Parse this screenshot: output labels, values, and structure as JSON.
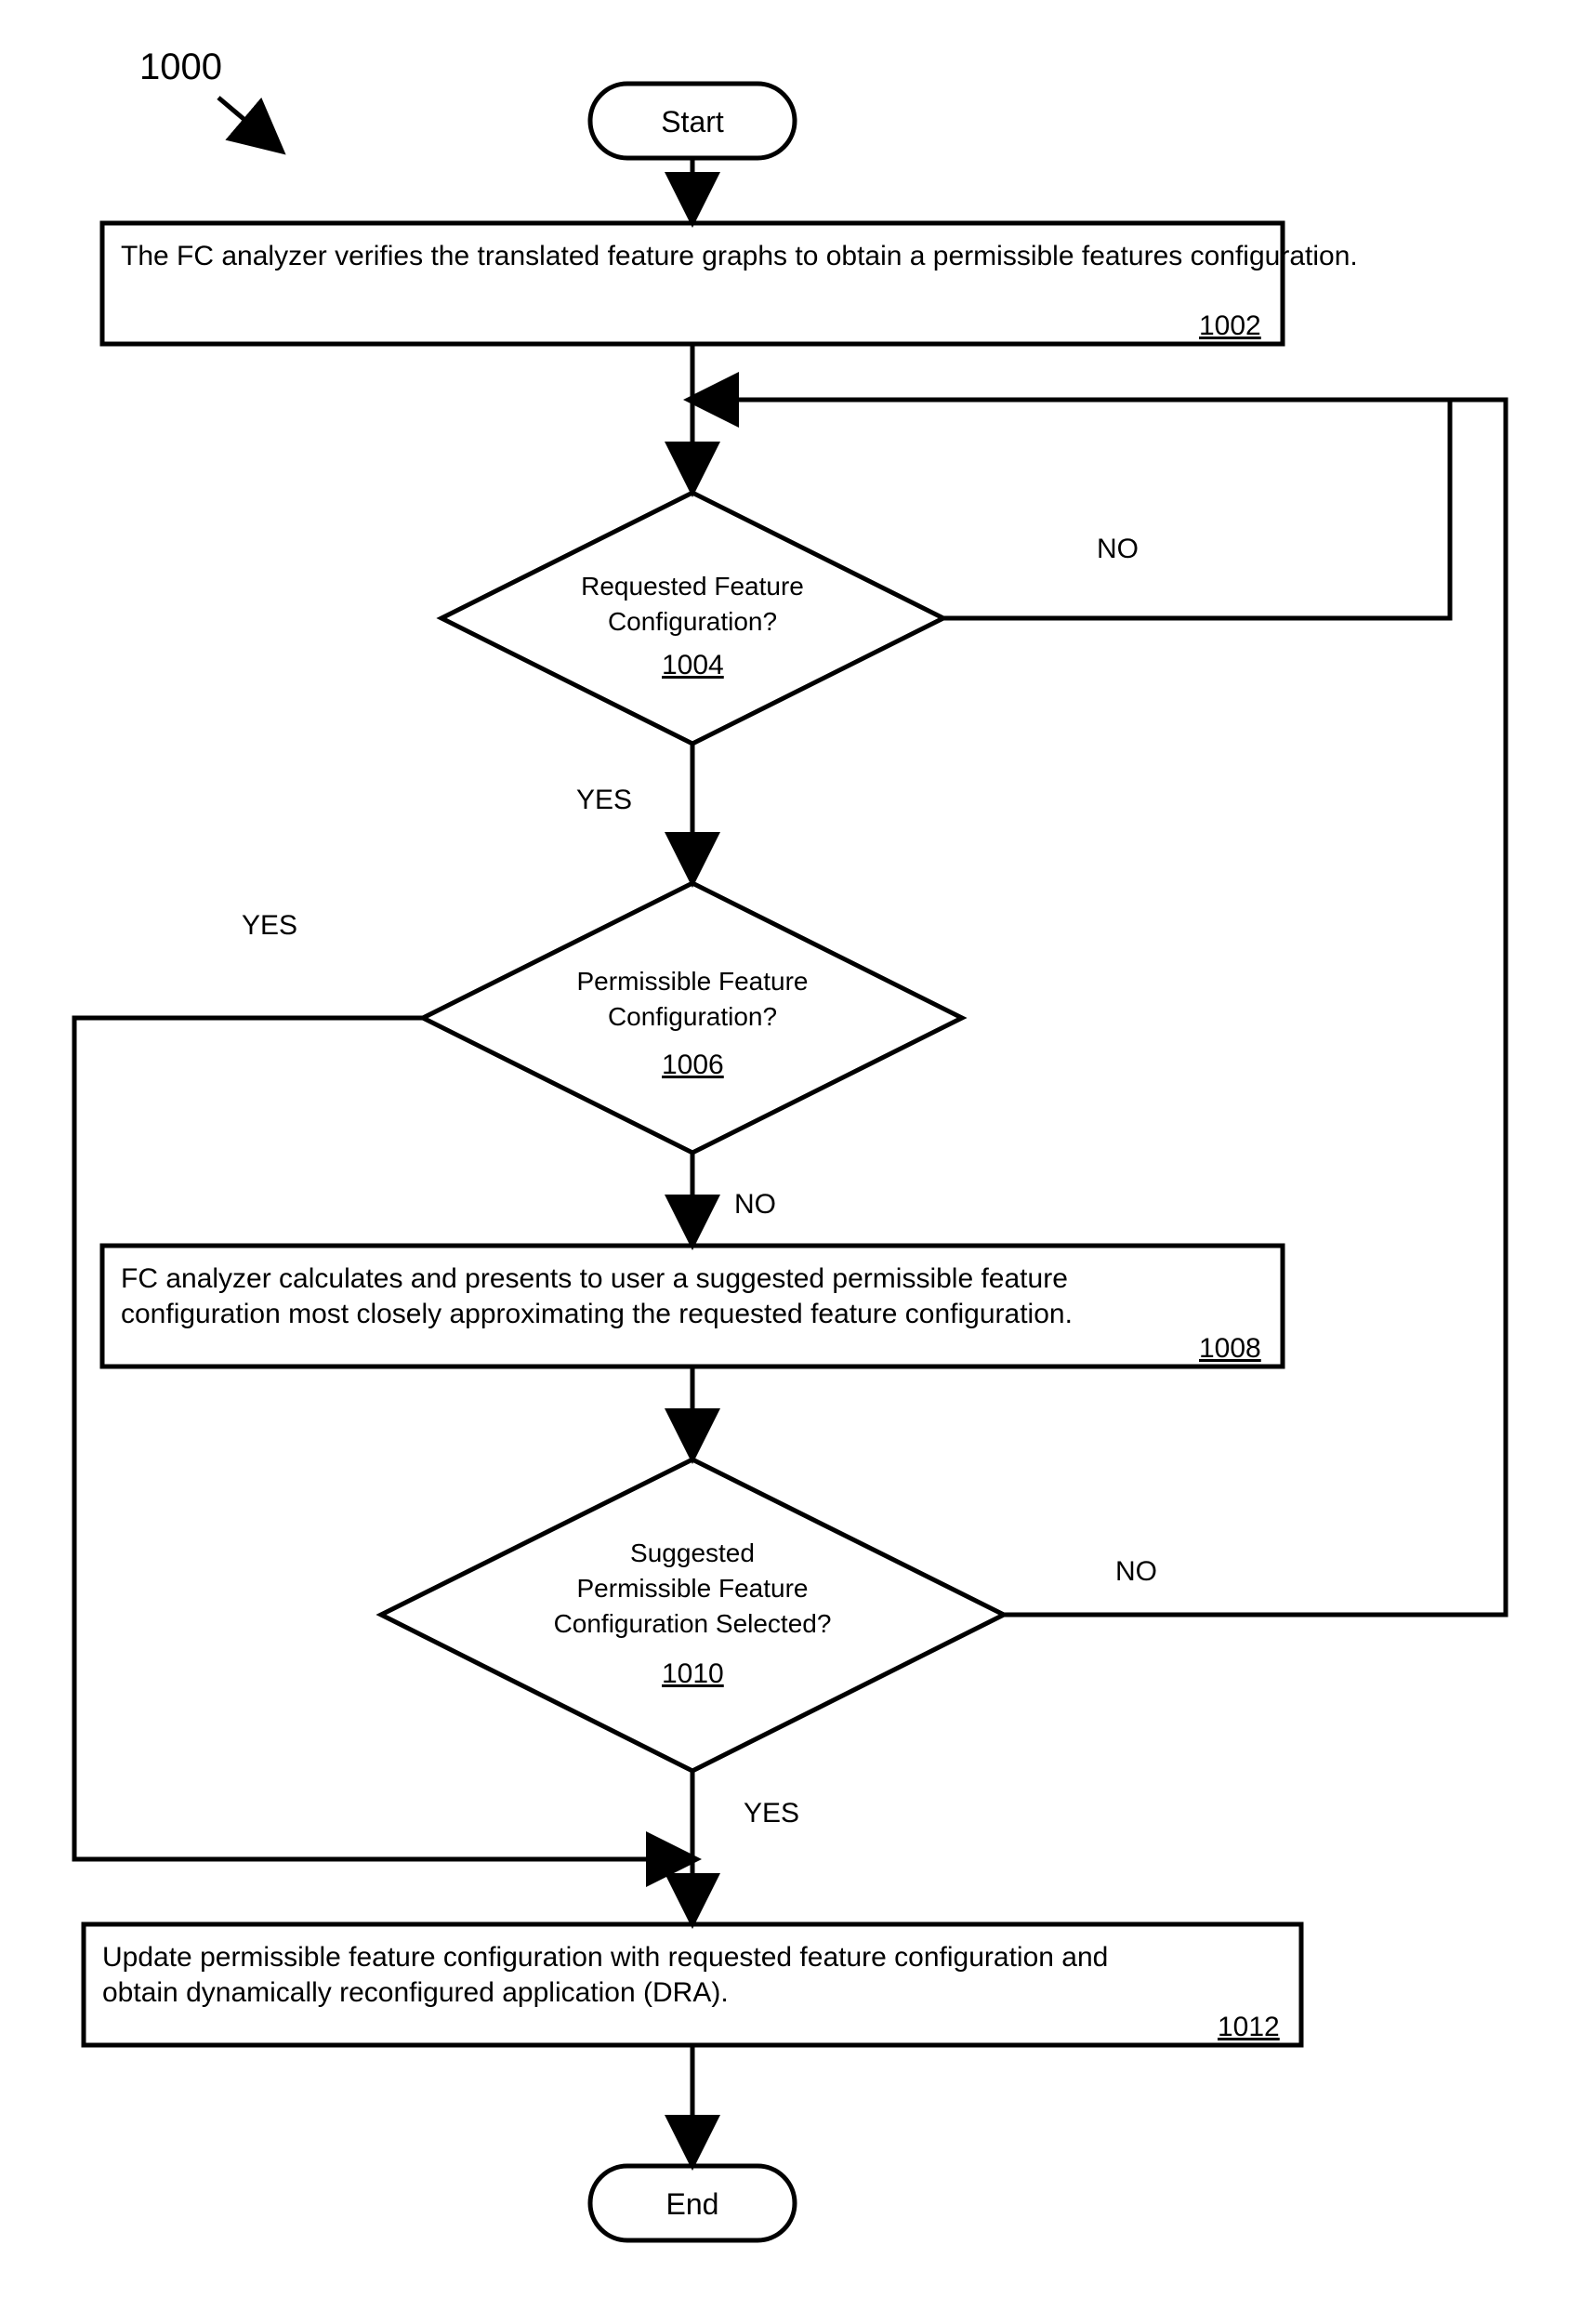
{
  "figure_number": "1000",
  "start": "Start",
  "end": "End",
  "box_1002": {
    "text": "The FC analyzer verifies the translated feature graphs to obtain a permissible features configuration.",
    "ref": "1002"
  },
  "diamond_1004": {
    "line1": "Requested Feature",
    "line2": "Configuration?",
    "ref": "1004",
    "yes": "YES",
    "no": "NO"
  },
  "diamond_1006": {
    "line1": "Permissible Feature",
    "line2": "Configuration?",
    "ref": "1006",
    "yes": "YES",
    "no": "NO"
  },
  "box_1008": {
    "text": "FC analyzer calculates and presents to user a suggested permissible feature configuration most closely approximating the requested feature configuration.",
    "ref": "1008"
  },
  "diamond_1010": {
    "line1": "Suggested",
    "line2": "Permissible Feature",
    "line3": "Configuration Selected?",
    "ref": "1010",
    "yes": "YES",
    "no": "NO"
  },
  "box_1012": {
    "text": "Update permissible feature configuration with requested feature configuration and obtain dynamically reconfigured application (DRA).",
    "ref": "1012"
  }
}
